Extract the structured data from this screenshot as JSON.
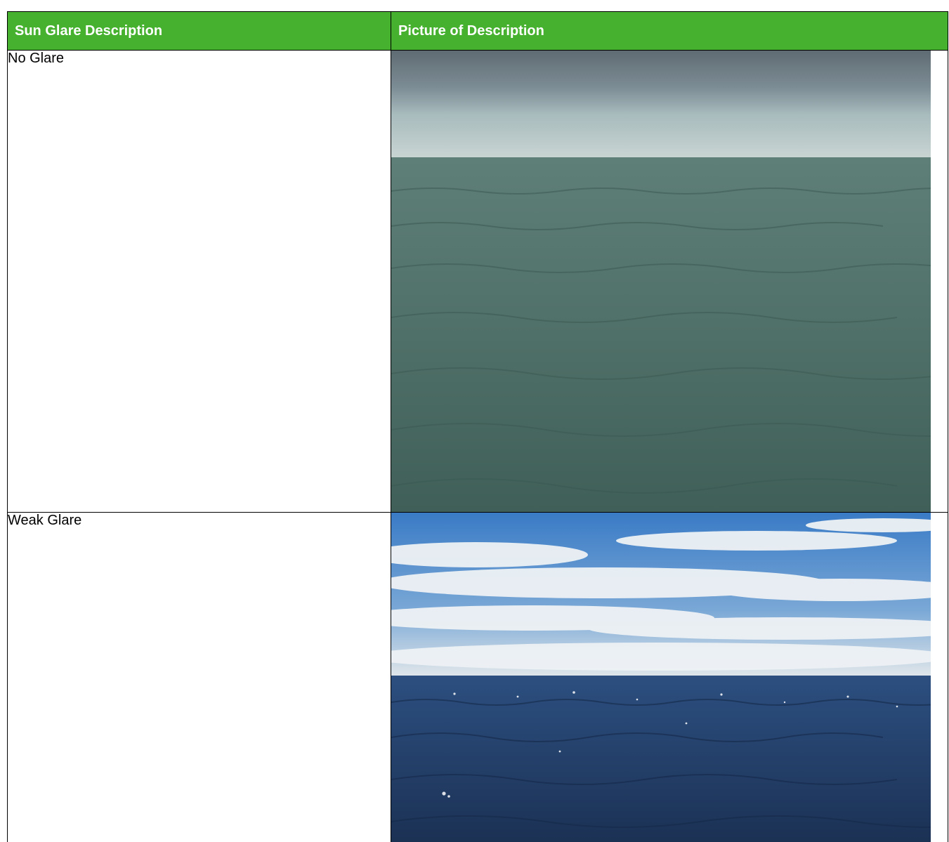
{
  "table": {
    "headers": {
      "col1": "Sun Glare Description",
      "col2": "Picture of Description"
    },
    "rows": [
      {
        "description": "No Glare",
        "picture": "overcast-sea-photo",
        "colors": {
          "sky_top": "#6e7c86",
          "sky_mid": "#9fb2b6",
          "horizon": "#c3d0cf",
          "water": "#4f7068"
        }
      },
      {
        "description": "Weak Glare",
        "picture": "partly-cloudy-sea-photo",
        "colors": {
          "sky_top": "#3f7fc8",
          "cloud": "#e8eef3",
          "horizon": "#dfe6ea",
          "water": "#24406a"
        }
      }
    ]
  },
  "colors": {
    "header_bg": "#46b12f",
    "header_text": "#ffffff",
    "border": "#000000"
  }
}
